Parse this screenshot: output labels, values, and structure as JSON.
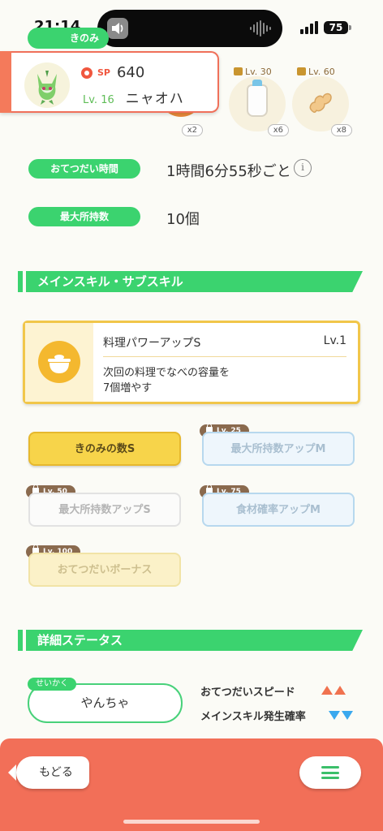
{
  "status_bar": {
    "time": "21:14",
    "battery": "75"
  },
  "top": {
    "partial_pill": "きのみ",
    "ingredients": [
      {
        "lock_label": "",
        "count": "x2"
      },
      {
        "lock_label": "Lv. 30",
        "count": "x6"
      },
      {
        "lock_label": "Lv. 60",
        "count": "x8"
      }
    ]
  },
  "pokemon": {
    "sp_label": "SP",
    "sp_value": "640",
    "level": "Lv. 16",
    "name": "ニャオハ"
  },
  "info": {
    "help_time_label": "おてつだい時間",
    "help_time_value": "1時間6分55秒ごと",
    "max_carry_label": "最大所持数",
    "max_carry_value": "10個",
    "info_icon": "i"
  },
  "skills_section": {
    "title": "メインスキル・サブスキル",
    "main_skill": {
      "name": "料理パワーアップS",
      "level": "Lv.1",
      "desc_line1": "次回の料理でなべの容量を",
      "desc_line2": "7個増やす"
    },
    "sub_skills": [
      {
        "label": "きのみの数S",
        "lock": ""
      },
      {
        "label": "最大所持数アップM",
        "lock": "Lv. 25"
      },
      {
        "label": "最大所持数アップS",
        "lock": "Lv. 50"
      },
      {
        "label": "食材確率アップM",
        "lock": "Lv. 75"
      },
      {
        "label": "おてつだいボーナス",
        "lock": "Lv. 100"
      }
    ]
  },
  "details_section": {
    "title": "詳細ステータス",
    "nature_tag": "せいかく",
    "nature": "やんちゃ",
    "up_label": "おてつだいスピード",
    "down_label": "メインスキル発生確率",
    "colors": {
      "up": "#f0724f",
      "down": "#3aa8ee"
    }
  },
  "bottom": {
    "back_label": "もどる",
    "menu_icon": "hamburger-icon"
  }
}
